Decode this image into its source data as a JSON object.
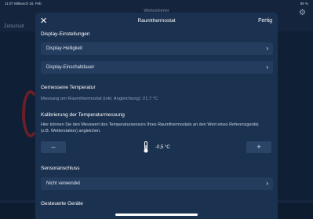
{
  "status_bar": {
    "time": "11:07",
    "date": "Mittwoch 16. Feb.",
    "battery": "85 %"
  },
  "background": {
    "title": "Wohnzimmer",
    "tab": "Zeitschalt"
  },
  "modal": {
    "close_icon": "close-icon",
    "title": "Raumthermostat",
    "done_label": "Fertig",
    "display_section": {
      "title": "Display-Einstellungen",
      "items": [
        {
          "label": "Display-Helligkeit"
        },
        {
          "label": "Display-Einschaltdauer"
        }
      ]
    },
    "measured_section": {
      "title": "Gemessene Temperatur",
      "info": "Messung am Raumthermostat (inkl. Angleichung): 21,7 °C"
    },
    "calibration_section": {
      "title": "Kalibrierung der Temperaturmessung",
      "description": "Hier können Sie den Messwert des Temperatursensors Ihres Raumthermostats an den Wert eines Referenzgeräts (z.B. Wetterstation) angleichen.",
      "minus_label": "–",
      "plus_label": "+",
      "value": "-0,5 °C"
    },
    "sensor_section": {
      "title": "Sensoranschluss",
      "value": "Nicht verwendet"
    },
    "controlled_section": {
      "title": "Gesteuerte Geräte"
    }
  },
  "colors": {
    "modal_bg": "#1b3150",
    "row_bg": "#243c5e",
    "info_text": "#8ea3bf"
  }
}
